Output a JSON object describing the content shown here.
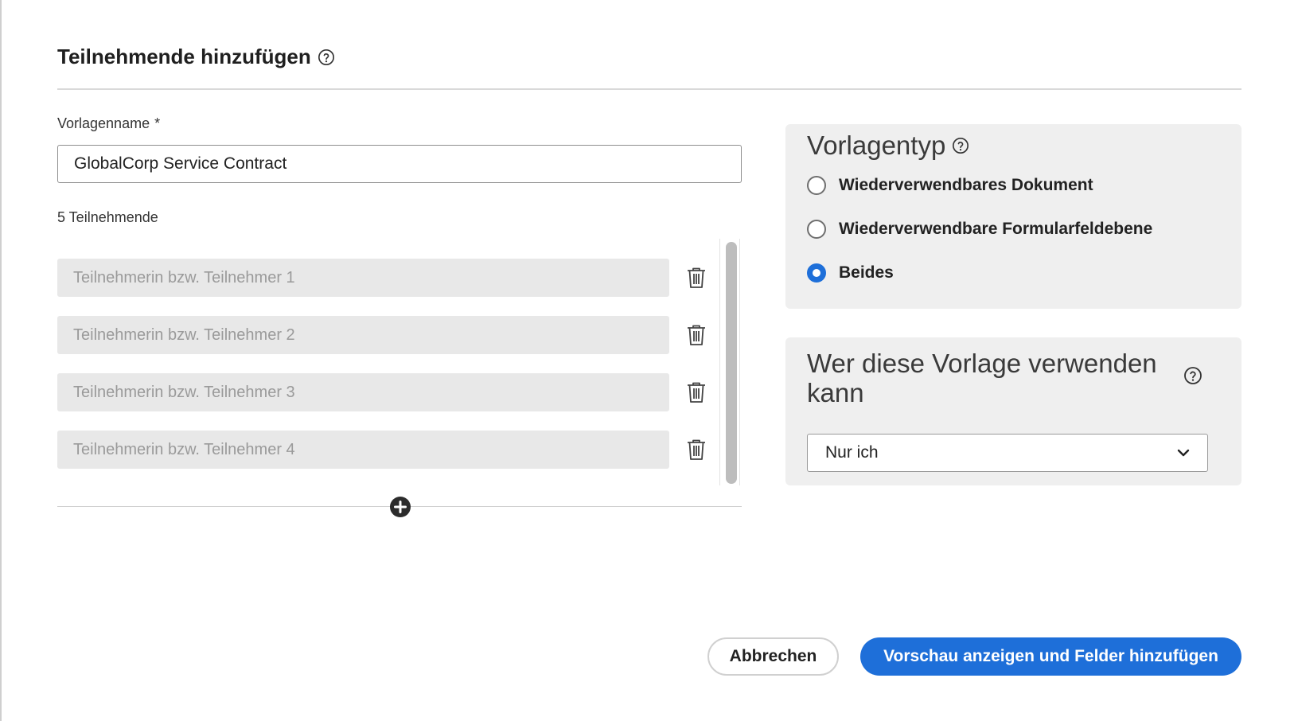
{
  "dialog": {
    "title": "Teilnehmende hinzufügen"
  },
  "template_name": {
    "label": "Vorlagenname",
    "required_marker": "*",
    "value": "GlobalCorp Service Contract"
  },
  "participants": {
    "count_label": "5 Teilnehmende",
    "items": [
      {
        "placeholder": "Teilnehmerin bzw. Teilnehmer 1"
      },
      {
        "placeholder": "Teilnehmerin bzw. Teilnehmer 2"
      },
      {
        "placeholder": "Teilnehmerin bzw. Teilnehmer 3"
      },
      {
        "placeholder": "Teilnehmerin bzw. Teilnehmer 4"
      }
    ]
  },
  "template_type": {
    "title": "Vorlagentyp",
    "options": [
      {
        "label": "Wiederverwendbares Dokument",
        "checked": false
      },
      {
        "label": "Wiederverwendbare Formularfeldebene",
        "checked": false
      },
      {
        "label": "Beides",
        "checked": true
      }
    ]
  },
  "who_can_use": {
    "title": "Wer diese Vorlage verwenden kann",
    "selected": "Nur ich"
  },
  "buttons": {
    "cancel": "Abbrechen",
    "primary": "Vorschau anzeigen und Felder hinzufügen"
  },
  "colors": {
    "accent": "#1e6fd9",
    "panel_bg": "#efefef",
    "input_disabled_bg": "#e8e8e8"
  },
  "icons": {
    "help": "help-circle-icon",
    "delete": "trash-icon",
    "add": "plus-circle-icon",
    "dropdown": "chevron-down-icon"
  }
}
